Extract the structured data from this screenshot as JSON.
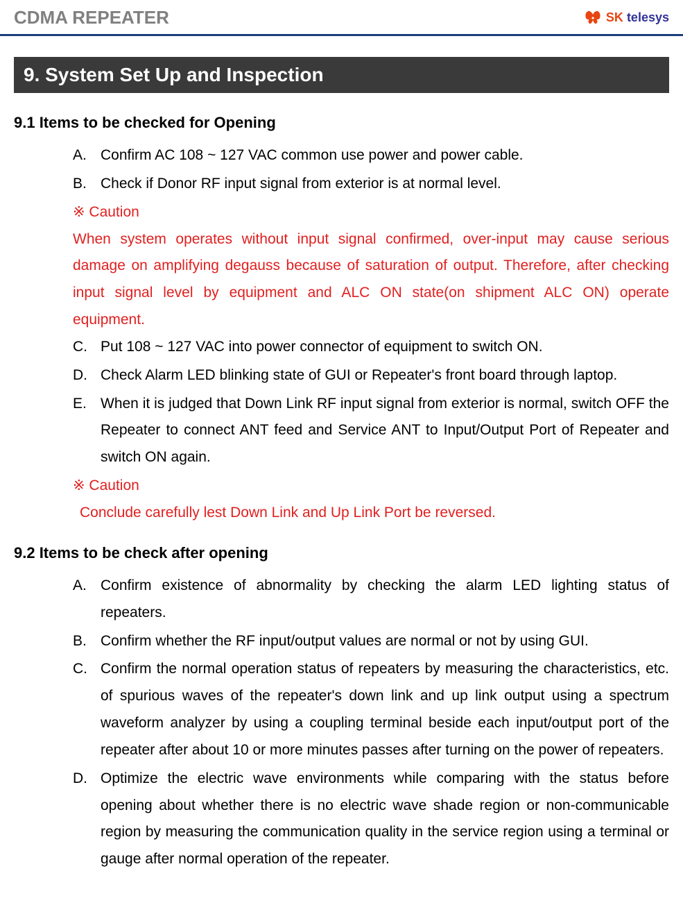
{
  "header": {
    "title": "CDMA REPEATER",
    "logo_sk": "SK",
    "logo_telesys": " telesys"
  },
  "section": {
    "number_title": "9. System Set Up and Inspection"
  },
  "subsection1": {
    "title": "9.1  Items to be checked for Opening",
    "items": {
      "a_letter": "A.",
      "a_text": "Confirm AC 108 ~ 127 VAC common use power and power cable.",
      "b_letter": "B.",
      "b_text": "Check if Donor RF input signal from exterior is at normal level.",
      "caution1_label": "※ Caution",
      "caution1_text": "When system operates without input signal confirmed, over-input may cause serious damage on amplifying degauss because of saturation of output. Therefore, after checking input signal level by equipment and ALC ON state(on shipment ALC ON) operate equipment.",
      "c_letter": "C.",
      "c_text": "Put 108 ~ 127 VAC into power connector of equipment to switch ON.",
      "d_letter": "D.",
      "d_text": "Check Alarm LED blinking state of GUI or Repeater's front board through laptop.",
      "e_letter": "E.",
      "e_text": "When it is judged that Down Link RF input signal from exterior is normal, switch OFF the Repeater to connect ANT feed and Service ANT to Input/Output Port of Repeater and switch ON again.",
      "caution2_label": "※ Caution",
      "caution2_text": "Conclude carefully lest Down Link and Up Link Port be reversed."
    }
  },
  "subsection2": {
    "title": "9.2  Items to be check after opening",
    "items": {
      "a_letter": "A.",
      "a_text": "Confirm existence of abnormality by checking the alarm LED lighting status of repeaters.",
      "b_letter": "B.",
      "b_text": "Confirm whether the RF input/output values are normal or not by using GUI.",
      "c_letter": "C.",
      "c_text": "Confirm the normal operation status of repeaters by measuring the characteristics, etc. of spurious waves of the repeater's down link and up link output using a spectrum waveform analyzer by using a coupling terminal beside each input/output port of the repeater after about 10 or more minutes passes after turning on the power of repeaters.",
      "d_letter": "D.",
      "d_text": "Optimize the electric wave environments while comparing with the status before opening about whether there is no electric wave shade region or non-communicable region by measuring the communication quality in the service region using a terminal or gauge after normal operation of the repeater."
    }
  }
}
